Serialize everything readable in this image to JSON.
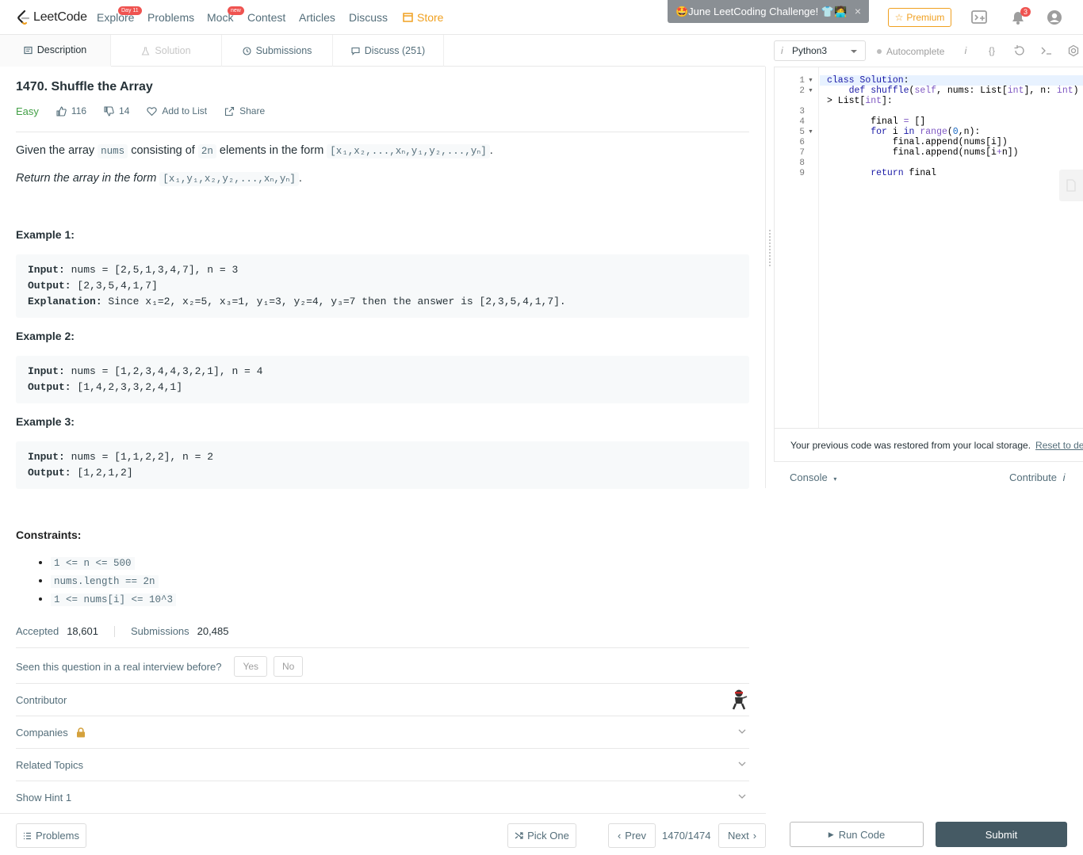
{
  "nav": {
    "logo": "LeetCode",
    "links": [
      "Explore",
      "Problems",
      "Mock",
      "Contest",
      "Articles",
      "Discuss"
    ],
    "explore_badge": "Day 11",
    "mock_badge": "new",
    "store": "Store",
    "challenge": "🤩June LeetCoding Challenge! 👕🧑‍💻",
    "challenge_close": "×",
    "premium": "Premium",
    "notifications_count": "3"
  },
  "tabs": [
    "Description",
    "Solution",
    "Submissions",
    "Discuss (251)"
  ],
  "problem": {
    "title": "1470. Shuffle the Array",
    "difficulty": "Easy",
    "likes": "116",
    "dislikes": "14",
    "add_to_list": "Add to List",
    "share": "Share",
    "p1_a": "Given the array ",
    "p1_code1": "nums",
    "p1_b": " consisting of ",
    "p1_code2": "2n",
    "p1_c": " elements in the form ",
    "p1_code3": "[x₁,x₂,...,xₙ,y₁,y₂,...,yₙ]",
    "p1_d": ".",
    "p2_a": "Return the array in the form ",
    "p2_code": "[x₁,y₁,x₂,y₂,...,xₙ,yₙ]",
    "p2_b": "."
  },
  "examples": [
    {
      "heading": "Example 1:",
      "input_label": "Input:",
      "input": " nums = [2,5,1,3,4,7], n = 3",
      "output_label": "Output:",
      "output": " [2,3,5,4,1,7]",
      "explanation_label": "Explanation:",
      "explanation": " Since x₁=2, x₂=5, x₃=1, y₁=3, y₂=4, y₃=7 then the answer is [2,3,5,4,1,7]."
    },
    {
      "heading": "Example 2:",
      "input_label": "Input:",
      "input": " nums = [1,2,3,4,4,3,2,1], n = 4",
      "output_label": "Output:",
      "output": " [1,4,2,3,3,2,4,1]"
    },
    {
      "heading": "Example 3:",
      "input_label": "Input:",
      "input": " nums = [1,1,2,2], n = 2",
      "output_label": "Output:",
      "output": " [1,2,1,2]"
    }
  ],
  "constraints": {
    "heading": "Constraints:",
    "items": [
      "1 <= n <= 500",
      "nums.length == 2n",
      "1 <= nums[i] <= 10^3"
    ]
  },
  "stats": {
    "accepted_label": "Accepted",
    "accepted": "18,601",
    "submissions_label": "Submissions",
    "submissions": "20,485"
  },
  "interview": {
    "question": "Seen this question in a real interview before?",
    "yes": "Yes",
    "no": "No"
  },
  "sections": [
    "Contributor",
    "Companies",
    "Related Topics",
    "Show Hint 1"
  ],
  "bottom": {
    "problems": "Problems",
    "pick_one": "Pick One",
    "prev": "Prev",
    "pager": "1470/1474",
    "next": "Next"
  },
  "editor": {
    "language": "Python3",
    "language_icon": "i",
    "autocomplete": "Autocomplete",
    "line_numbers": [
      "1",
      "2",
      "",
      "3",
      "4",
      "5",
      "6",
      "7",
      "8",
      "9"
    ],
    "restore_message": "Your previous code was restored from your local storage.",
    "reset_link": "Reset to default",
    "console": "Console",
    "contribute": "Contribute",
    "run": "Run Code",
    "submit": "Submit"
  },
  "colors": {
    "accent": "#f0a020",
    "easy": "#43a047",
    "submit_bg": "#455a64"
  }
}
